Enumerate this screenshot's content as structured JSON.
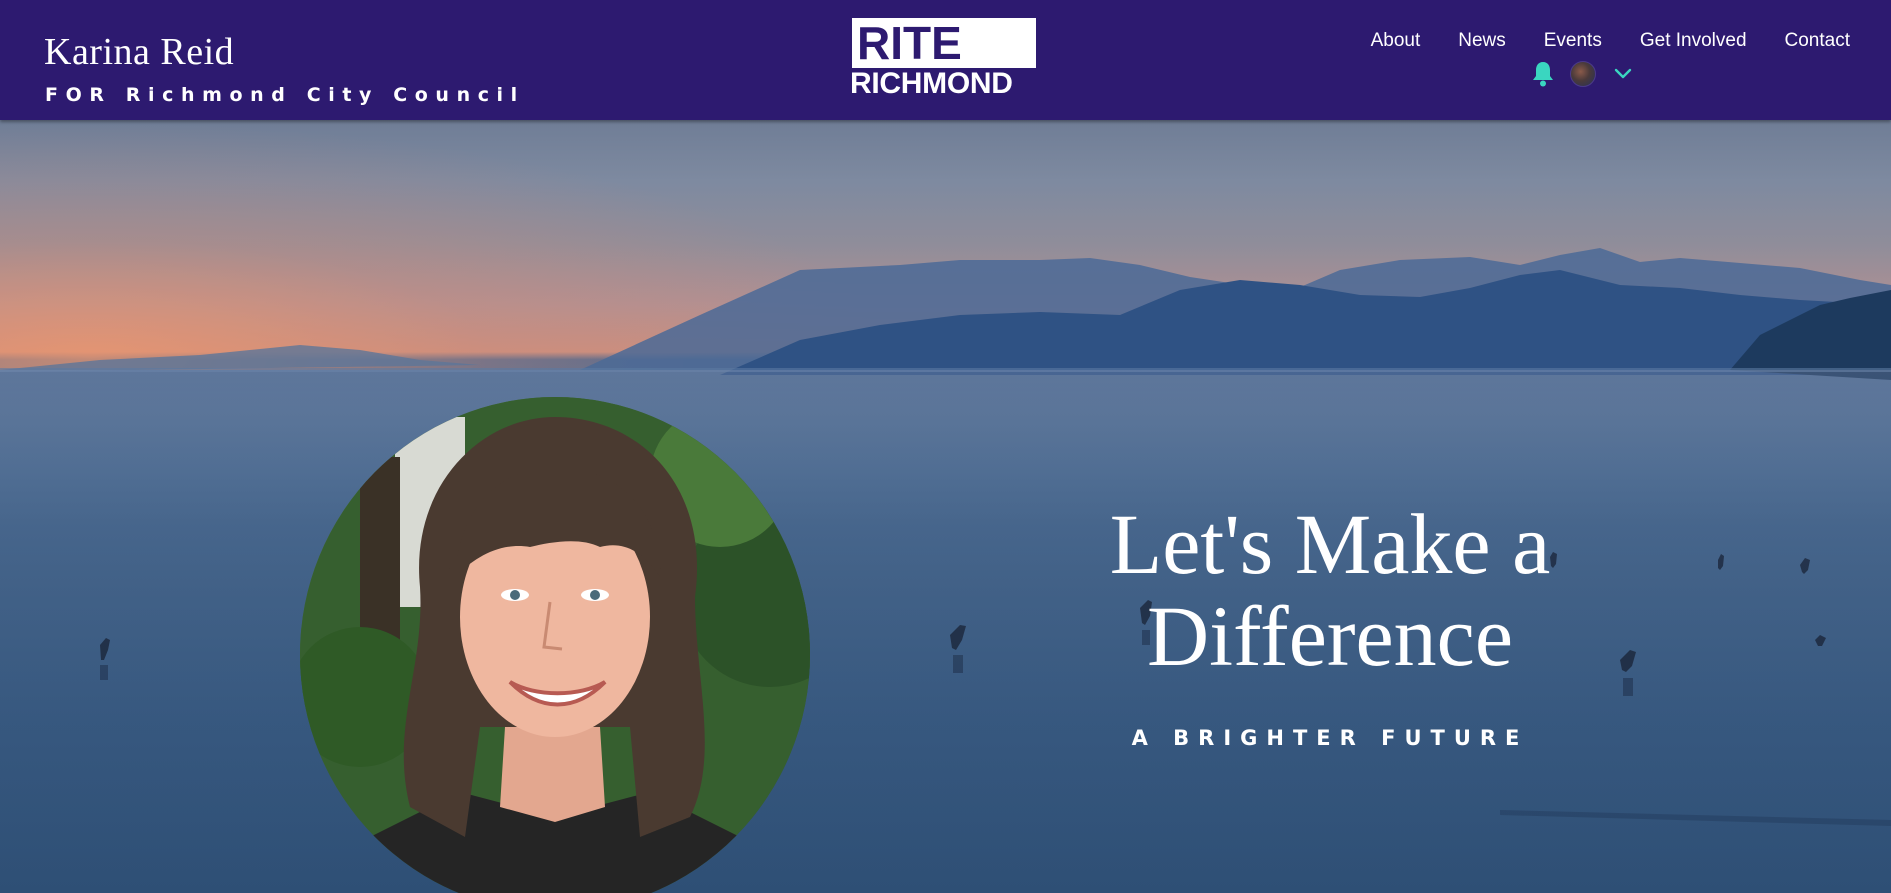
{
  "header": {
    "candidate_name": "Karina Reid",
    "candidate_subtitle": "FOR Richmond City Council",
    "logo_top": "RITE",
    "logo_bottom": "RICHMOND",
    "nav": [
      "About",
      "News",
      "Events",
      "Get Involved",
      "Contact"
    ],
    "member_icons": [
      "bell-icon",
      "avatar",
      "chevron-down-icon"
    ]
  },
  "hero": {
    "headline_line1": "Let's Make a",
    "headline_line2": "Difference",
    "tagline": "A BRIGHTER FUTURE"
  },
  "colors": {
    "header_bg": "#2d1a70",
    "accent_teal": "#3ad6c0",
    "text": "#ffffff"
  }
}
